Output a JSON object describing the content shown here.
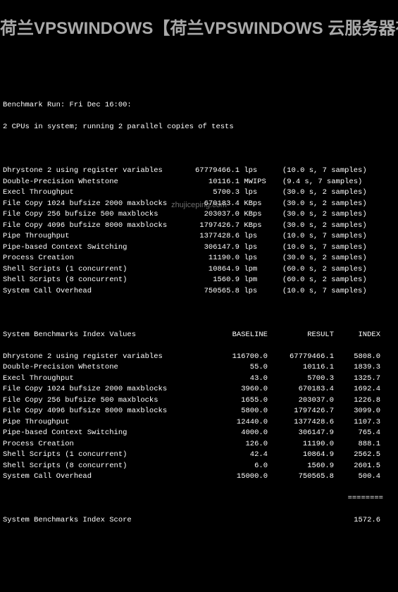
{
  "title": "荷兰VPSWINDOWS【荷兰VPSWINDOWS 云服务器有什么优势？】",
  "watermark": "zhujiceping.com",
  "header_line1": "Benchmark Run: Fri Dec 16:00:",
  "header_line2": "2 CPUs in system; running 2 parallel copies of tests",
  "bench": [
    {
      "name": "Dhrystone 2 using register variables",
      "val": "67779466.1",
      "unit": "lps",
      "meta": "(10.0 s, 7 samples)"
    },
    {
      "name": "Double-Precision Whetstone",
      "val": "10116.1",
      "unit": "MWIPS",
      "meta": "(9.4 s, 7 samples)"
    },
    {
      "name": "Execl Throughput",
      "val": "5700.3",
      "unit": "lps",
      "meta": "(30.0 s, 2 samples)"
    },
    {
      "name": "File Copy 1024 bufsize 2000 maxblocks",
      "val": "670183.4",
      "unit": "KBps",
      "meta": "(30.0 s, 2 samples)"
    },
    {
      "name": "File Copy 256 bufsize 500 maxblocks",
      "val": "203037.0",
      "unit": "KBps",
      "meta": "(30.0 s, 2 samples)"
    },
    {
      "name": "File Copy 4096 bufsize 8000 maxblocks",
      "val": "1797426.7",
      "unit": "KBps",
      "meta": "(30.0 s, 2 samples)"
    },
    {
      "name": "Pipe Throughput",
      "val": "1377428.6",
      "unit": "lps",
      "meta": "(10.0 s, 7 samples)"
    },
    {
      "name": "Pipe-based Context Switching",
      "val": "306147.9",
      "unit": "lps",
      "meta": "(10.0 s, 7 samples)"
    },
    {
      "name": "Process Creation",
      "val": "11190.0",
      "unit": "lps",
      "meta": "(30.0 s, 2 samples)"
    },
    {
      "name": "Shell Scripts (1 concurrent)",
      "val": "10864.9",
      "unit": "lpm",
      "meta": "(60.0 s, 2 samples)"
    },
    {
      "name": "Shell Scripts (8 concurrent)",
      "val": "1560.9",
      "unit": "lpm",
      "meta": "(60.0 s, 2 samples)"
    },
    {
      "name": "System Call Overhead",
      "val": "750565.8",
      "unit": "lps",
      "meta": "(10.0 s, 7 samples)"
    }
  ],
  "idx_header": {
    "title": "System Benchmarks Index Values",
    "c1": "BASELINE",
    "c2": "RESULT",
    "c3": "INDEX"
  },
  "idx": [
    {
      "name": "Dhrystone 2 using register variables",
      "baseline": "116700.0",
      "result": "67779466.1",
      "index": "5808.0"
    },
    {
      "name": "Double-Precision Whetstone",
      "baseline": "55.0",
      "result": "10116.1",
      "index": "1839.3"
    },
    {
      "name": "Execl Throughput",
      "baseline": "43.0",
      "result": "5700.3",
      "index": "1325.7"
    },
    {
      "name": "File Copy 1024 bufsize 2000 maxblocks",
      "baseline": "3960.0",
      "result": "670183.4",
      "index": "1692.4"
    },
    {
      "name": "File Copy 256 bufsize 500 maxblocks",
      "baseline": "1655.0",
      "result": "203037.0",
      "index": "1226.8"
    },
    {
      "name": "File Copy 4096 bufsize 8000 maxblocks",
      "baseline": "5800.0",
      "result": "1797426.7",
      "index": "3099.0"
    },
    {
      "name": "Pipe Throughput",
      "baseline": "12440.0",
      "result": "1377428.6",
      "index": "1107.3"
    },
    {
      "name": "Pipe-based Context Switching",
      "baseline": "4000.0",
      "result": "306147.9",
      "index": "765.4"
    },
    {
      "name": "Process Creation",
      "baseline": "126.0",
      "result": "11190.0",
      "index": "888.1"
    },
    {
      "name": "Shell Scripts (1 concurrent)",
      "baseline": "42.4",
      "result": "10864.9",
      "index": "2562.5"
    },
    {
      "name": "Shell Scripts (8 concurrent)",
      "baseline": "6.0",
      "result": "1560.9",
      "index": "2601.5"
    },
    {
      "name": "System Call Overhead",
      "baseline": "15000.0",
      "result": "750565.8",
      "index": "500.4"
    }
  ],
  "divider": "========",
  "score_label": "System Benchmarks Index Score",
  "score_value": "1572.6"
}
